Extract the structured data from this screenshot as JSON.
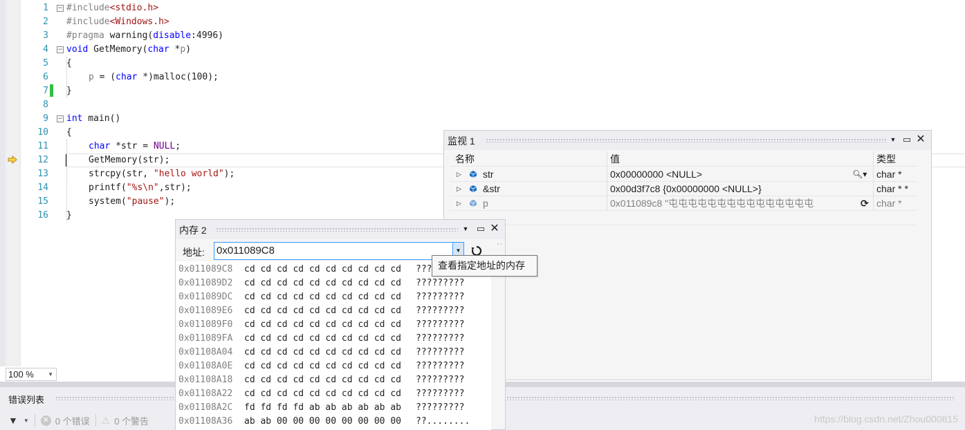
{
  "editor": {
    "lines": [
      {
        "n": "1",
        "parts": [
          [
            "pp",
            "#include"
          ],
          [
            "str",
            "<stdio.h>"
          ]
        ],
        "indent": 0,
        "fold": "-"
      },
      {
        "n": "2",
        "parts": [
          [
            "pp",
            "#include"
          ],
          [
            "str",
            "<Windows.h>"
          ]
        ],
        "indent": 0,
        "fold": ""
      },
      {
        "n": "3",
        "parts": [
          [
            "pp",
            "#pragma"
          ],
          [
            "",
            " warning("
          ],
          [
            "kw",
            "disable"
          ],
          [
            "",
            ":4996)"
          ]
        ],
        "indent": 0,
        "fold": ""
      },
      {
        "n": "4",
        "parts": [
          [
            "kw",
            "void"
          ],
          [
            "",
            " GetMemory("
          ],
          [
            "kw",
            "char"
          ],
          [
            "",
            " *"
          ],
          [
            "par",
            "p"
          ],
          [
            "",
            ")"
          ]
        ],
        "indent": 0,
        "fold": "-"
      },
      {
        "n": "5",
        "parts": [
          [
            "",
            "{"
          ]
        ],
        "indent": 0,
        "fold": ""
      },
      {
        "n": "6",
        "parts": [
          [
            "par",
            "p"
          ],
          [
            "",
            " = ("
          ],
          [
            "kw",
            "char"
          ],
          [
            "",
            " *)malloc(100);"
          ]
        ],
        "indent": 1,
        "fold": ""
      },
      {
        "n": "7",
        "parts": [
          [
            "",
            "}"
          ]
        ],
        "indent": 0,
        "fold": ""
      },
      {
        "n": "8",
        "parts": [],
        "indent": 0,
        "fold": ""
      },
      {
        "n": "9",
        "parts": [
          [
            "kw",
            "int"
          ],
          [
            "",
            " main()"
          ]
        ],
        "indent": 0,
        "fold": "-"
      },
      {
        "n": "10",
        "parts": [
          [
            "",
            "{"
          ]
        ],
        "indent": 0,
        "fold": ""
      },
      {
        "n": "11",
        "parts": [
          [
            "kw",
            "char"
          ],
          [
            "",
            " *str = "
          ],
          [
            "mac",
            "NULL"
          ],
          [
            "",
            ";"
          ]
        ],
        "indent": 1,
        "fold": ""
      },
      {
        "n": "12",
        "parts": [
          [
            "",
            "GetMemory(str);"
          ]
        ],
        "indent": 1,
        "fold": ""
      },
      {
        "n": "13",
        "parts": [
          [
            "",
            "strcpy(str, "
          ],
          [
            "str",
            "\"hello world\""
          ],
          [
            "",
            ");"
          ]
        ],
        "indent": 1,
        "fold": ""
      },
      {
        "n": "14",
        "parts": [
          [
            "",
            "printf("
          ],
          [
            "str",
            "\"%s\\n\""
          ],
          [
            "",
            ",str);"
          ]
        ],
        "indent": 1,
        "fold": ""
      },
      {
        "n": "15",
        "parts": [
          [
            "",
            "system("
          ],
          [
            "str",
            "\"pause\""
          ],
          [
            "",
            ");"
          ]
        ],
        "indent": 1,
        "fold": ""
      },
      {
        "n": "16",
        "parts": [
          [
            "",
            "}"
          ]
        ],
        "indent": 0,
        "fold": ""
      }
    ],
    "zoom": "100 %",
    "current_line": 12
  },
  "error_list": {
    "title": "错误列表",
    "errors": "0 个错误",
    "warnings": "0 个警告"
  },
  "watermark": "https://blog.csdn.net/Zhou000815",
  "watch": {
    "title": "监视 1",
    "columns": {
      "name": "名称",
      "value": "值",
      "type": "类型"
    },
    "rows": [
      {
        "name": "str",
        "value": "0x00000000 <NULL>",
        "type": "char *",
        "muted": false
      },
      {
        "name": "&str",
        "value": "0x00d3f7c8 {0x00000000 <NULL>}",
        "type": "char * *",
        "muted": false
      },
      {
        "name": "p",
        "value": "0x011089c8 \"屯屯屯屯屯屯屯屯屯屯屯屯屯屯屯",
        "type": "char *",
        "muted": true
      }
    ]
  },
  "memory": {
    "title": "内存 2",
    "address_label": "地址:",
    "address_value": "0x011089C8",
    "tooltip": "查看指定地址的内存",
    "rows": [
      {
        "addr": "0x011089C8",
        "bytes": "cd cd cd cd cd cd cd cd cd cd",
        "ascii": "???"
      },
      {
        "addr": "0x011089D2",
        "bytes": "cd cd cd cd cd cd cd cd cd cd",
        "ascii": "?????????"
      },
      {
        "addr": "0x011089DC",
        "bytes": "cd cd cd cd cd cd cd cd cd cd",
        "ascii": "?????????"
      },
      {
        "addr": "0x011089E6",
        "bytes": "cd cd cd cd cd cd cd cd cd cd",
        "ascii": "?????????"
      },
      {
        "addr": "0x011089F0",
        "bytes": "cd cd cd cd cd cd cd cd cd cd",
        "ascii": "?????????"
      },
      {
        "addr": "0x011089FA",
        "bytes": "cd cd cd cd cd cd cd cd cd cd",
        "ascii": "?????????"
      },
      {
        "addr": "0x01108A04",
        "bytes": "cd cd cd cd cd cd cd cd cd cd",
        "ascii": "?????????"
      },
      {
        "addr": "0x01108A0E",
        "bytes": "cd cd cd cd cd cd cd cd cd cd",
        "ascii": "?????????"
      },
      {
        "addr": "0x01108A18",
        "bytes": "cd cd cd cd cd cd cd cd cd cd",
        "ascii": "?????????"
      },
      {
        "addr": "0x01108A22",
        "bytes": "cd cd cd cd cd cd cd cd cd cd",
        "ascii": "?????????"
      },
      {
        "addr": "0x01108A2C",
        "bytes": "fd fd fd fd ab ab ab ab ab ab",
        "ascii": "?????????"
      },
      {
        "addr": "0x01108A36",
        "bytes": "ab ab 00 00 00 00 00 00 00 00",
        "ascii": "??........"
      }
    ]
  },
  "colors": {
    "keyword": "#0000ff",
    "string": "#a31515",
    "line_number": "#2b91af",
    "macro": "#6f008a",
    "changed_bar": "#2fbf3f",
    "ip_arrow": "#ffd54a"
  }
}
